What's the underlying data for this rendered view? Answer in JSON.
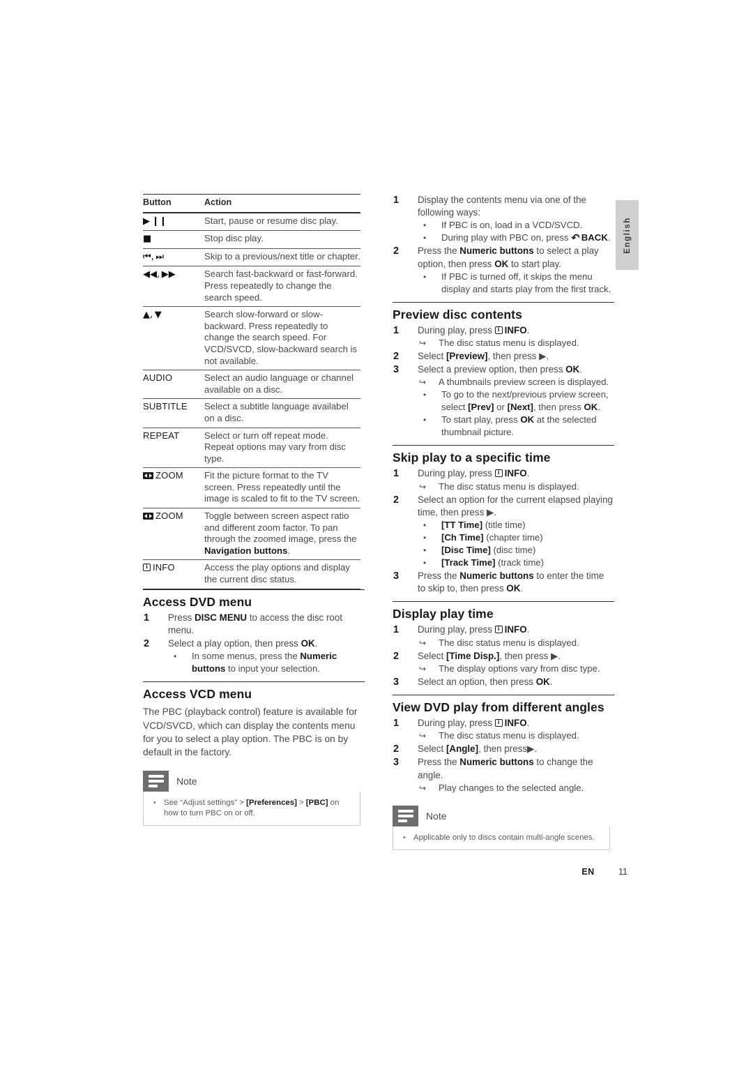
{
  "page": {
    "language_tab": "English",
    "footer": {
      "locale": "EN",
      "page_number": "11"
    }
  },
  "left_column": {
    "table": {
      "headers": [
        "Button",
        "Action"
      ],
      "rows": [
        {
          "button_icon": "play-pause-icon",
          "button": "▶ ❙❙",
          "action": "Start, pause or resume disc play."
        },
        {
          "button_icon": "stop-icon",
          "button": "■",
          "action": "Stop disc play."
        },
        {
          "button_icon": "skip-prev-next-icon",
          "button": "⏮, ⏭",
          "action": "Skip to a previous/next title or chapter."
        },
        {
          "button_icon": "fast-rewind-forward-icon",
          "button": "◀◀, ▶▶",
          "action": "Search fast-backward or fast-forward. Press repeatedly to change the search speed."
        },
        {
          "button_icon": "up-down-arrows-icon",
          "button": "▲, ▼",
          "action": "Search slow-forward or slow-backward. Press repeatedly to change the search speed. For VCD/SVCD, slow-backward search is not available."
        },
        {
          "button_icon": "audio-button-icon",
          "button": "AUDIO",
          "action": "Select an audio language or channel available on a disc."
        },
        {
          "button_icon": "subtitle-button-icon",
          "button": "SUBTITLE",
          "action": "Select a subtitle language availabel on a disc."
        },
        {
          "button_icon": "repeat-button-icon",
          "button": "REPEAT",
          "action": "Select or turn off repeat mode. Repeat options may vary from disc type."
        },
        {
          "button_icon": "zoom-icon",
          "button": "ZOOM",
          "action": "Fit the picture format to the TV screen. Press repeatedly until the image is scaled to fit to the TV screen."
        },
        {
          "button_icon": "zoom-icon",
          "button": "ZOOM",
          "action_parts": [
            {
              "t": "Toggle between screen aspect ratio and different zoom factor. To pan through the zoomed image, press the ",
              "b": false
            },
            {
              "t": "Navigation buttons",
              "b": true
            },
            {
              "t": ".",
              "b": false
            }
          ]
        },
        {
          "button_icon": "info-icon",
          "button": "INFO",
          "action": "Access the play options and display the current disc status."
        }
      ]
    },
    "access_dvd_menu": {
      "heading": "Access DVD menu",
      "steps": [
        {
          "num": "1",
          "parts": [
            {
              "t": "Press ",
              "b": false
            },
            {
              "t": "DISC MENU",
              "b": true
            },
            {
              "t": " to access the disc root menu.",
              "b": false
            }
          ]
        },
        {
          "num": "2",
          "parts": [
            {
              "t": "Select a play option, then press ",
              "b": false
            },
            {
              "t": "OK",
              "b": true
            },
            {
              "t": ".",
              "b": false
            }
          ],
          "subs": [
            {
              "parts": [
                {
                  "t": "In some menus, press the ",
                  "b": false
                },
                {
                  "t": "Numeric buttons",
                  "b": true
                },
                {
                  "t": " to input your selection.",
                  "b": false
                }
              ]
            }
          ]
        }
      ]
    },
    "access_vcd_menu": {
      "heading": "Access VCD menu",
      "paragraph": "The PBC (playback control) feature is available for VCD/SVCD, which can display the contents menu for you to select a play option. The PBC is on by default in the factory.",
      "note": {
        "title": "Note",
        "items": [
          {
            "parts": [
              {
                "t": "See “Adjust settings” > ",
                "b": false
              },
              {
                "t": "[Preferences]",
                "b": true
              },
              {
                "t": " > ",
                "b": false
              },
              {
                "t": "[PBC]",
                "b": true
              },
              {
                "t": " on how to turn PBC on or off.",
                "b": false
              }
            ]
          }
        ]
      }
    }
  },
  "right_column": {
    "vcd_steps": {
      "steps": [
        {
          "num": "1",
          "parts": [
            {
              "t": "Display the contents menu via one of the following ways:",
              "b": false
            }
          ],
          "subs": [
            {
              "parts": [
                {
                  "t": "If PBC is on, load in a VCD/SVCD.",
                  "b": false
                }
              ]
            },
            {
              "parts": [
                {
                  "t": "During play with PBC on, press ",
                  "b": false
                },
                {
                  "t": "BACK",
                  "b": true,
                  "icon": "back-arrow-icon"
                },
                {
                  "t": ".",
                  "b": false
                }
              ]
            }
          ]
        },
        {
          "num": "2",
          "parts": [
            {
              "t": "Press the ",
              "b": false
            },
            {
              "t": "Numeric buttons",
              "b": true
            },
            {
              "t": " to select a play option, then press ",
              "b": false
            },
            {
              "t": "OK",
              "b": true
            },
            {
              "t": " to start play.",
              "b": false
            }
          ],
          "subs": [
            {
              "parts": [
                {
                  "t": "If PBC is turned off, it skips the menu display and starts play from the first track.",
                  "b": false
                }
              ]
            }
          ]
        }
      ]
    },
    "preview_disc_contents": {
      "heading": "Preview disc contents",
      "steps": [
        {
          "num": "1",
          "parts": [
            {
              "t": "During play, press ",
              "b": false
            },
            {
              "t": "INFO",
              "b": true,
              "icon": "info-icon"
            },
            {
              "t": ".",
              "b": false
            }
          ],
          "arrows": [
            "The disc status menu is displayed."
          ]
        },
        {
          "num": "2",
          "parts": [
            {
              "t": "Select ",
              "b": false
            },
            {
              "t": "[Preview]",
              "b": true
            },
            {
              "t": ", then press ▶.",
              "b": false
            }
          ]
        },
        {
          "num": "3",
          "parts": [
            {
              "t": "Select a preview option, then press ",
              "b": false
            },
            {
              "t": "OK",
              "b": true
            },
            {
              "t": ".",
              "b": false
            }
          ],
          "arrows": [
            "A thumbnails preview screen is displayed."
          ],
          "subs": [
            {
              "parts": [
                {
                  "t": "To go to the next/previous prview screen, select ",
                  "b": false
                },
                {
                  "t": "[Prev]",
                  "b": true
                },
                {
                  "t": " or ",
                  "b": false
                },
                {
                  "t": "[Next]",
                  "b": true
                },
                {
                  "t": ", then press ",
                  "b": false
                },
                {
                  "t": "OK",
                  "b": true
                },
                {
                  "t": ".",
                  "b": false
                }
              ]
            },
            {
              "parts": [
                {
                  "t": "To start play, press ",
                  "b": false
                },
                {
                  "t": "OK",
                  "b": true
                },
                {
                  "t": " at the selected thumbnail picture.",
                  "b": false
                }
              ]
            }
          ]
        }
      ]
    },
    "skip_play_specific_time": {
      "heading": "Skip play to a specific time",
      "steps": [
        {
          "num": "1",
          "parts": [
            {
              "t": "During play, press ",
              "b": false
            },
            {
              "t": "INFO",
              "b": true,
              "icon": "info-icon"
            },
            {
              "t": ".",
              "b": false
            }
          ],
          "arrows": [
            "The disc status menu is displayed."
          ]
        },
        {
          "num": "2",
          "parts": [
            {
              "t": "Select an option for the current elapsed playing time, then press ▶.",
              "b": false
            }
          ],
          "subs": [
            {
              "parts": [
                {
                  "t": "[TT Time]",
                  "b": true
                },
                {
                  "t": " (title time)",
                  "b": false
                }
              ]
            },
            {
              "parts": [
                {
                  "t": "[Ch Time]",
                  "b": true
                },
                {
                  "t": " (chapter time)",
                  "b": false
                }
              ]
            },
            {
              "parts": [
                {
                  "t": "[Disc Time]",
                  "b": true
                },
                {
                  "t": " (disc time)",
                  "b": false
                }
              ]
            },
            {
              "parts": [
                {
                  "t": "[Track Time]",
                  "b": true
                },
                {
                  "t": " (track time)",
                  "b": false
                }
              ]
            }
          ]
        },
        {
          "num": "3",
          "parts": [
            {
              "t": "Press the ",
              "b": false
            },
            {
              "t": "Numeric buttons",
              "b": true
            },
            {
              "t": " to enter the time to skip to, then press ",
              "b": false
            },
            {
              "t": "OK",
              "b": true
            },
            {
              "t": ".",
              "b": false
            }
          ]
        }
      ]
    },
    "display_play_time": {
      "heading": "Display play time",
      "steps": [
        {
          "num": "1",
          "parts": [
            {
              "t": "During play, press ",
              "b": false
            },
            {
              "t": "INFO",
              "b": true,
              "icon": "info-icon"
            },
            {
              "t": ".",
              "b": false
            }
          ],
          "arrows": [
            "The disc status menu is displayed."
          ]
        },
        {
          "num": "2",
          "parts": [
            {
              "t": "Select ",
              "b": false
            },
            {
              "t": "[Time Disp.]",
              "b": true
            },
            {
              "t": ", then press ▶.",
              "b": false
            }
          ],
          "arrows": [
            "The display options vary from disc type."
          ]
        },
        {
          "num": "3",
          "parts": [
            {
              "t": "Select an option, then press ",
              "b": false
            },
            {
              "t": "OK",
              "b": true
            },
            {
              "t": ".",
              "b": false
            }
          ]
        }
      ]
    },
    "view_dvd_angles": {
      "heading": "View DVD play from different angles",
      "steps": [
        {
          "num": "1",
          "parts": [
            {
              "t": "During play, press ",
              "b": false
            },
            {
              "t": "INFO",
              "b": true,
              "icon": "info-icon"
            },
            {
              "t": ".",
              "b": false
            }
          ],
          "arrows": [
            "The disc status menu is displayed."
          ]
        },
        {
          "num": "2",
          "parts": [
            {
              "t": "Select ",
              "b": false
            },
            {
              "t": "[Angle]",
              "b": true
            },
            {
              "t": ", then press▶.",
              "b": false
            }
          ]
        },
        {
          "num": "3",
          "parts": [
            {
              "t": "Press the ",
              "b": false
            },
            {
              "t": "Numeric buttons",
              "b": true
            },
            {
              "t": " to change the angle.",
              "b": false
            }
          ],
          "arrows": [
            "Play changes to the selected angle."
          ]
        }
      ],
      "note": {
        "title": "Note",
        "items": [
          {
            "parts": [
              {
                "t": "Applicable only to discs contain multi-angle scenes.",
                "b": false
              }
            ]
          }
        ]
      }
    }
  }
}
